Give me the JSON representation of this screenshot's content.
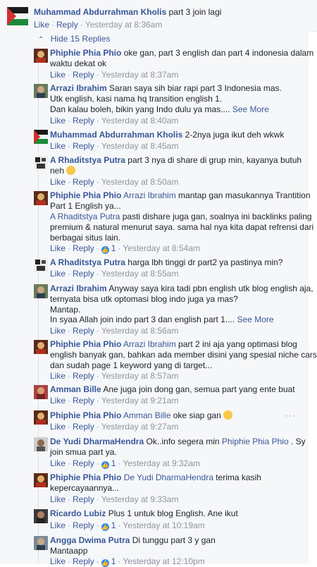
{
  "top": {
    "name": "Muhammad Abdurrahman Kholis",
    "text": "part 3 join lagi",
    "like": "Like",
    "reply": "Reply",
    "time": "Yesterday at 8:36am"
  },
  "hide_label": "Hide 15 Replies",
  "replies": [
    {
      "name": "Phiphie Phia Phio",
      "lines": [
        "oke gan, part 3 english dan part 4 indonesia dalam",
        "waktu dekat ok"
      ],
      "like": "Like",
      "reply": "Reply",
      "time": "Yesterday at 8:37am"
    },
    {
      "name": "Arrazi Ibrahim",
      "lines": [
        "Saran saya sih biar rapi part 3 Indonesia mas.",
        "Utk english, kasi nama hq transition english 1.",
        "Dan kalau boleh, bikin yang Indo dulu ya mas...."
      ],
      "more": "See More",
      "like": "Like",
      "reply": "Reply",
      "time": "Yesterday at 8:40am"
    },
    {
      "name": "Muhammad Abdurrahman Kholis",
      "lines": [
        "2-2nya juga ikut deh wkwk"
      ],
      "like": "Like",
      "reply": "Reply",
      "time": "Yesterday at 8:45am"
    },
    {
      "name": "A Rhaditstya Putra",
      "lines": [
        "part 3 nya di share di grup min, kayanya butuh",
        "neh"
      ],
      "like": "Like",
      "reply": "Reply",
      "time": "Yesterday at 8:50am"
    },
    {
      "name": "Phiphie Phia Phio",
      "mention": "Arrazi Ibrahim",
      "lines": [
        "mantap gan masukannya Trantition",
        "Part 1 English ya..."
      ],
      "mention2": "A Rhaditstya Putra",
      "lines2": [
        "pasti dishare juga gan, soalnya ini backlinks paling",
        "premium & natural menurut saya. sama hal nya kita dapat refrensi dari",
        "berbagai situs lain."
      ],
      "like": "Like",
      "reply": "Reply",
      "count": "1",
      "time": "Yesterday at 8:54am"
    },
    {
      "name": "A Rhaditstya Putra",
      "lines": [
        "harga lbh tinggi dr part2 ya pastinya min?"
      ],
      "like": "Like",
      "reply": "Reply",
      "time": "Yesterday at 8:55am"
    },
    {
      "name": "Arrazi Ibrahim",
      "lines": [
        "Anyway saya kira tadi pbn english utk blog english aja,",
        "ternyata bisa utk optomasi blog indo juga ya mas?",
        "Mantap.",
        "In syaa Allah join indo part 3 dan english part 1...."
      ],
      "more": "See More",
      "like": "Like",
      "reply": "Reply",
      "time": "Yesterday at 8:56am"
    },
    {
      "name": "Phiphie Phia Phio",
      "mention": "Arrazi Ibrahim",
      "lines": [
        "part 2 ini aja yang optimasi blog",
        "english banyak gan, bahkan ada member disini yang spesial niche cars",
        "dan sudah page 1 keyword yang di target..."
      ],
      "like": "Like",
      "reply": "Reply",
      "time": "Yesterday at 8:57am"
    },
    {
      "name": "Amman Bille",
      "lines": [
        "Ane juga join dong gan, semua part yang ente buat"
      ],
      "like": "Like",
      "reply": "Reply",
      "time": "Yesterday at 9:21am"
    },
    {
      "name": "Phiphie Phia Phio",
      "mention": "Amman Bille",
      "lines": [
        "oke siap gan"
      ],
      "like": "Like",
      "reply": "Reply",
      "time": "Yesterday at 9:27am"
    },
    {
      "name": "De Yudi DharmaHendra",
      "lines": [
        "Ok..info segera min"
      ],
      "mention": "Phiphie Phia Phio",
      "tail": ". Sy",
      "lines2": [
        "join smua part ya."
      ],
      "like": "Like",
      "reply": "Reply",
      "count": "1",
      "time": "Yesterday at 9:32am"
    },
    {
      "name": "Phiphie Phia Phio",
      "mention": "De Yudi DharmaHendra",
      "lines": [
        "terima kasih",
        "kepercayaannya..."
      ],
      "like": "Like",
      "reply": "Reply",
      "time": "Yesterday at 9:33am"
    },
    {
      "name": "Ricardo Lubiz",
      "lines": [
        "Plus 1 untuk blog English. Ane ikut"
      ],
      "like": "Like",
      "reply": "Reply",
      "count": "1",
      "time": "Yesterday at 10:19am"
    },
    {
      "name": "Angga Dwima Putra",
      "lines": [
        "Di tunggu part 3 y gan",
        "Mantaapp"
      ],
      "like": "Like",
      "reply": "Reply",
      "count": "1",
      "time": "Yesterday at 12:10pm"
    }
  ],
  "colors": {
    "link": "#385898",
    "meta": "#90949c",
    "bg": "#f6f7f9"
  }
}
